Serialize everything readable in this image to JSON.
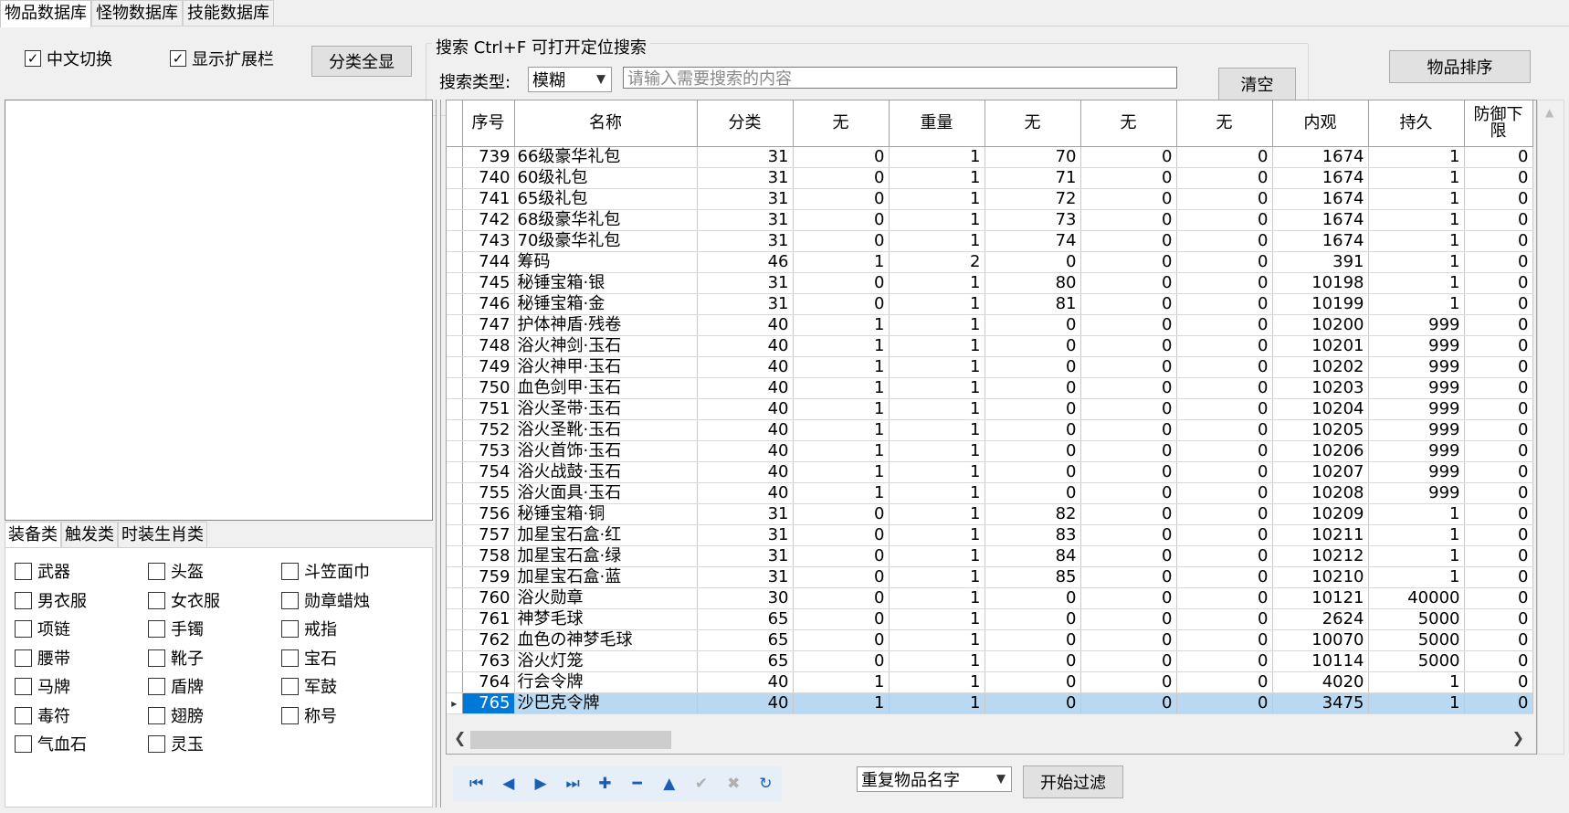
{
  "tabs": [
    {
      "label": "物品数据库",
      "active": true
    },
    {
      "label": "怪物数据库",
      "active": false
    },
    {
      "label": "技能数据库",
      "active": false
    }
  ],
  "toolbar": {
    "chinese_toggle_label": "中文切换",
    "chinese_toggle_checked": true,
    "show_ext_label": "显示扩展栏",
    "show_ext_checked": true,
    "show_all_categories_label": "分类全显",
    "sort_items_label": "物品排序"
  },
  "search": {
    "group_title": "搜索  Ctrl+F 可打开定位搜索",
    "type_label": "搜索类型:",
    "type_value": "模糊",
    "input_placeholder": "请输入需要搜索的内容",
    "clear_label": "清空"
  },
  "category_tabs": [
    {
      "label": "装备类",
      "active": true
    },
    {
      "label": "触发类",
      "active": false
    },
    {
      "label": "时装生肖类",
      "active": false
    }
  ],
  "categories": [
    [
      "武器",
      "头盔",
      "斗笠面巾"
    ],
    [
      "男衣服",
      "女衣服",
      "勋章蜡烛"
    ],
    [
      "项链",
      "手镯",
      "戒指"
    ],
    [
      "腰带",
      "靴子",
      "宝石"
    ],
    [
      "马牌",
      "盾牌",
      "军鼓"
    ],
    [
      "毒符",
      "翅膀",
      "称号"
    ],
    [
      "气血石",
      "灵玉"
    ]
  ],
  "grid": {
    "columns": [
      "序号",
      "名称",
      "分类",
      "无",
      "重量",
      "无",
      "无",
      "无",
      "内观",
      "持久",
      "防御下\n限"
    ],
    "rows": [
      [
        "739",
        "66级豪华礼包",
        "31",
        "0",
        "1",
        "70",
        "0",
        "0",
        "1674",
        "1",
        "0"
      ],
      [
        "740",
        "60级礼包",
        "31",
        "0",
        "1",
        "71",
        "0",
        "0",
        "1674",
        "1",
        "0"
      ],
      [
        "741",
        "65级礼包",
        "31",
        "0",
        "1",
        "72",
        "0",
        "0",
        "1674",
        "1",
        "0"
      ],
      [
        "742",
        "68级豪华礼包",
        "31",
        "0",
        "1",
        "73",
        "0",
        "0",
        "1674",
        "1",
        "0"
      ],
      [
        "743",
        "70级豪华礼包",
        "31",
        "0",
        "1",
        "74",
        "0",
        "0",
        "1674",
        "1",
        "0"
      ],
      [
        "744",
        "筹码",
        "46",
        "1",
        "2",
        "0",
        "0",
        "0",
        "391",
        "1",
        "0"
      ],
      [
        "745",
        "秘锤宝箱·银",
        "31",
        "0",
        "1",
        "80",
        "0",
        "0",
        "10198",
        "1",
        "0"
      ],
      [
        "746",
        "秘锤宝箱·金",
        "31",
        "0",
        "1",
        "81",
        "0",
        "0",
        "10199",
        "1",
        "0"
      ],
      [
        "747",
        "护体神盾·残卷",
        "40",
        "1",
        "1",
        "0",
        "0",
        "0",
        "10200",
        "999",
        "0"
      ],
      [
        "748",
        "浴火神剑·玉石",
        "40",
        "1",
        "1",
        "0",
        "0",
        "0",
        "10201",
        "999",
        "0"
      ],
      [
        "749",
        "浴火神甲·玉石",
        "40",
        "1",
        "1",
        "0",
        "0",
        "0",
        "10202",
        "999",
        "0"
      ],
      [
        "750",
        "血色剑甲·玉石",
        "40",
        "1",
        "1",
        "0",
        "0",
        "0",
        "10203",
        "999",
        "0"
      ],
      [
        "751",
        "浴火圣带·玉石",
        "40",
        "1",
        "1",
        "0",
        "0",
        "0",
        "10204",
        "999",
        "0"
      ],
      [
        "752",
        "浴火圣靴·玉石",
        "40",
        "1",
        "1",
        "0",
        "0",
        "0",
        "10205",
        "999",
        "0"
      ],
      [
        "753",
        "浴火首饰·玉石",
        "40",
        "1",
        "1",
        "0",
        "0",
        "0",
        "10206",
        "999",
        "0"
      ],
      [
        "754",
        "浴火战鼓·玉石",
        "40",
        "1",
        "1",
        "0",
        "0",
        "0",
        "10207",
        "999",
        "0"
      ],
      [
        "755",
        "浴火面具·玉石",
        "40",
        "1",
        "1",
        "0",
        "0",
        "0",
        "10208",
        "999",
        "0"
      ],
      [
        "756",
        "秘锤宝箱·铜",
        "31",
        "0",
        "1",
        "82",
        "0",
        "0",
        "10209",
        "1",
        "0"
      ],
      [
        "757",
        "加星宝石盒·红",
        "31",
        "0",
        "1",
        "83",
        "0",
        "0",
        "10211",
        "1",
        "0"
      ],
      [
        "758",
        "加星宝石盒·绿",
        "31",
        "0",
        "1",
        "84",
        "0",
        "0",
        "10212",
        "1",
        "0"
      ],
      [
        "759",
        "加星宝石盒·蓝",
        "31",
        "0",
        "1",
        "85",
        "0",
        "0",
        "10210",
        "1",
        "0"
      ],
      [
        "760",
        "浴火勋章",
        "30",
        "0",
        "1",
        "0",
        "0",
        "0",
        "10121",
        "40000",
        "0"
      ],
      [
        "761",
        "神梦毛球",
        "65",
        "0",
        "1",
        "0",
        "0",
        "0",
        "2624",
        "5000",
        "0"
      ],
      [
        "762",
        "血色の神梦毛球",
        "65",
        "0",
        "1",
        "0",
        "0",
        "0",
        "10070",
        "5000",
        "0"
      ],
      [
        "763",
        "浴火灯笼",
        "65",
        "0",
        "1",
        "0",
        "0",
        "0",
        "10114",
        "5000",
        "0"
      ],
      [
        "764",
        "行会令牌",
        "40",
        "1",
        "1",
        "0",
        "0",
        "0",
        "4020",
        "1",
        "0"
      ],
      [
        "765",
        "沙巴克令牌",
        "40",
        "1",
        "1",
        "0",
        "0",
        "0",
        "3475",
        "1",
        "0"
      ]
    ],
    "selected_row_index": 26
  },
  "nav_buttons": [
    {
      "icon": "first-record-icon",
      "glyph": "⏮",
      "enabled": true
    },
    {
      "icon": "prev-record-icon",
      "glyph": "◀",
      "enabled": true
    },
    {
      "icon": "next-record-icon",
      "glyph": "▶",
      "enabled": true
    },
    {
      "icon": "last-record-icon",
      "glyph": "⏭",
      "enabled": true
    },
    {
      "icon": "add-record-icon",
      "glyph": "✚",
      "enabled": true
    },
    {
      "icon": "delete-record-icon",
      "glyph": "━",
      "enabled": true
    },
    {
      "icon": "edit-record-icon",
      "glyph": "▲",
      "enabled": true
    },
    {
      "icon": "post-edit-icon",
      "glyph": "✔",
      "enabled": false
    },
    {
      "icon": "cancel-edit-icon",
      "glyph": "✖",
      "enabled": false
    },
    {
      "icon": "refresh-icon",
      "glyph": "↻",
      "enabled": true
    }
  ],
  "filter": {
    "select_value": "重复物品名字",
    "start_label": "开始过滤"
  },
  "colors": {
    "selected_row": "#b9d9f3",
    "selected_cell": "#0078d7",
    "nav_icon": "#1a5fb4"
  }
}
